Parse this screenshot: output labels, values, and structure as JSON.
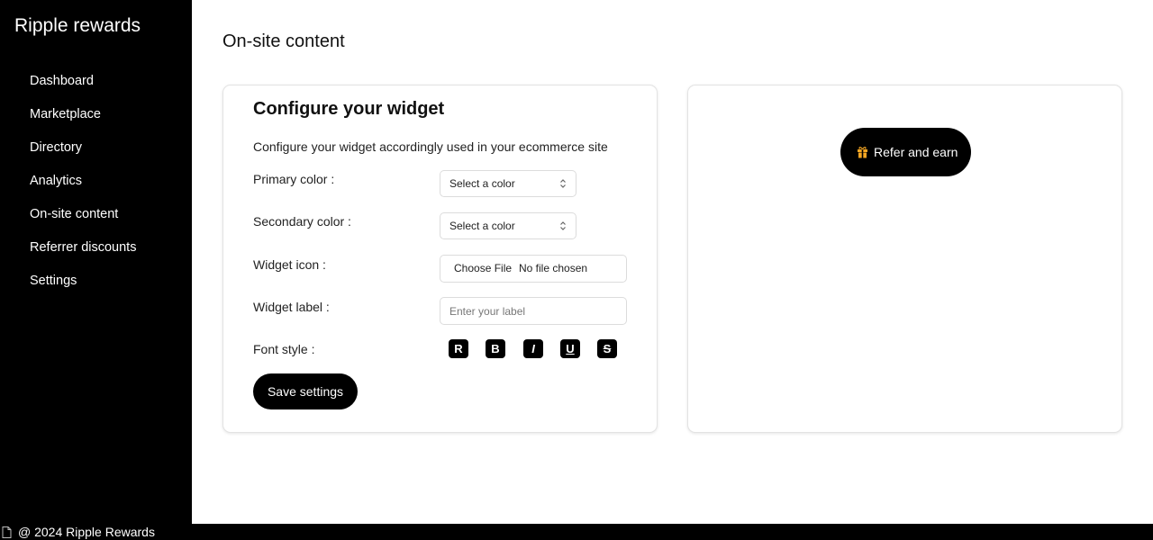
{
  "app": {
    "brand": "Ripple rewards"
  },
  "sidebar": {
    "items": [
      {
        "label": "Dashboard"
      },
      {
        "label": "Marketplace"
      },
      {
        "label": "Directory"
      },
      {
        "label": "Analytics"
      },
      {
        "label": "On-site content"
      },
      {
        "label": "Referrer discounts"
      },
      {
        "label": "Settings"
      }
    ]
  },
  "page": {
    "title": "On-site content"
  },
  "config": {
    "title": "Configure your widget",
    "description": "Configure your widget accordingly used in your ecommerce site",
    "primary_color": {
      "label": "Primary color :",
      "value": "Select a color"
    },
    "secondary_color": {
      "label": "Secondary color :",
      "value": "Select a color"
    },
    "widget_icon": {
      "label": "Widget icon :",
      "button": "Choose File",
      "status": "No file chosen"
    },
    "widget_label": {
      "label": "Widget label :",
      "placeholder": "Enter your label"
    },
    "font_style": {
      "label": "Font style :",
      "options": [
        "R",
        "B",
        "I",
        "U",
        "S"
      ]
    },
    "save_label": "Save settings"
  },
  "preview": {
    "button_label": "Refer and earn",
    "icon": "gift-icon",
    "icon_color": "#f5a623"
  },
  "footer": {
    "text": "@ 2024 Ripple Rewards",
    "icon": "document-icon"
  }
}
